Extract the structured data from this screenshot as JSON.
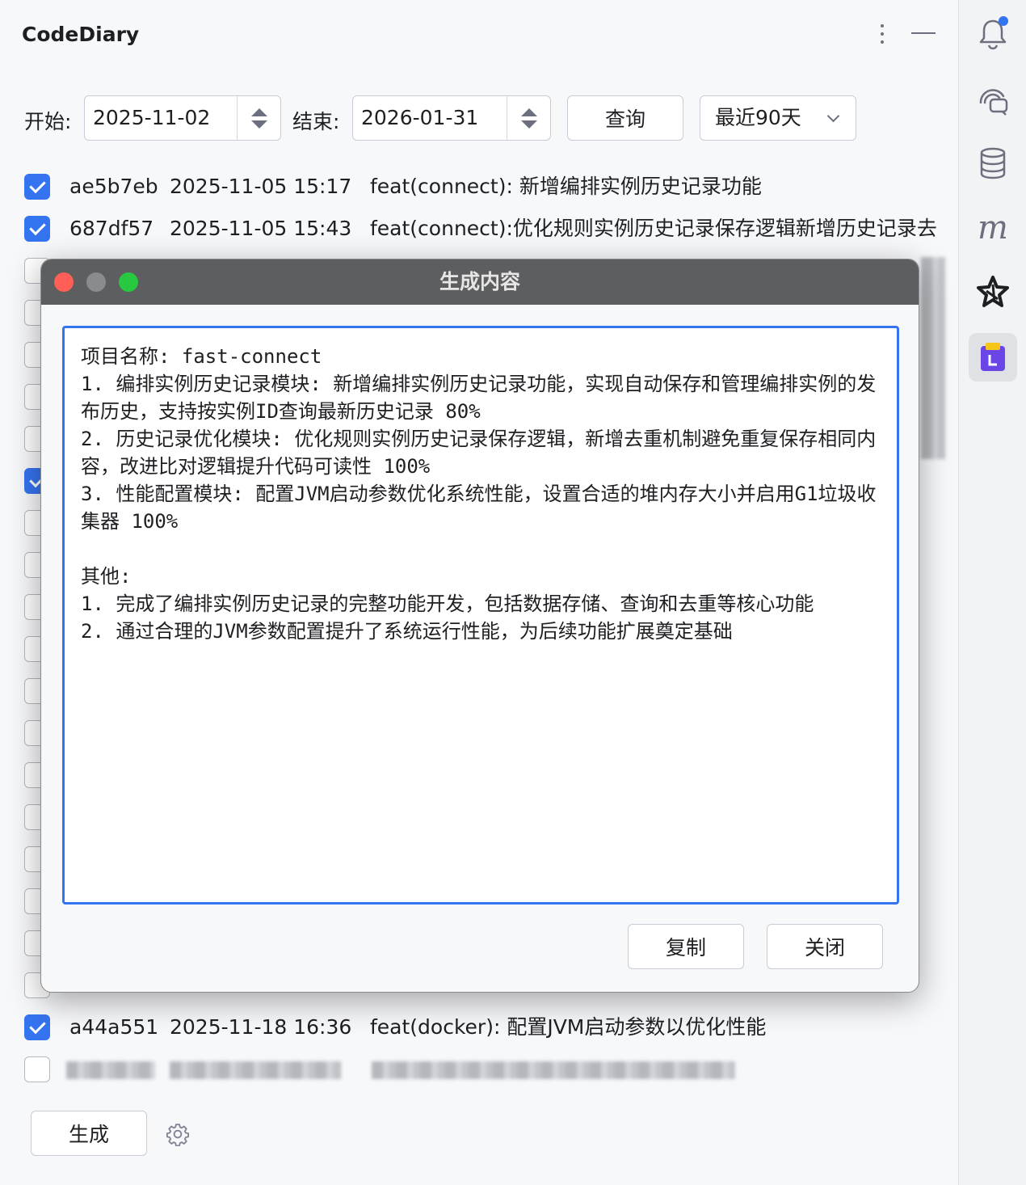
{
  "app": {
    "title": "CodeDiary"
  },
  "filters": {
    "start_label": "开始:",
    "start_value": "2025-11-02",
    "end_label": "结束:",
    "end_value": "2026-01-31",
    "query_label": "查询",
    "range_value": "最近90天"
  },
  "commits": [
    {
      "checked": true,
      "hash": "ae5b7eb",
      "date": "2025-11-05 15:17",
      "message": "feat(connect): 新增编排实例历史记录功能"
    },
    {
      "checked": true,
      "hash": "687df57",
      "date": "2025-11-05 15:43",
      "message": "feat(connect):优化规则实例历史记录保存逻辑新增历史记录去"
    },
    {
      "checked": true,
      "hash": "a44a551",
      "date": "2025-11-18 16:36",
      "message": "feat(docker): 配置JVM启动参数以优化性能"
    }
  ],
  "bottom": {
    "generate_label": "生成"
  },
  "dialog": {
    "title": "生成内容",
    "content": "项目名称: fast-connect\n1. 编排实例历史记录模块: 新增编排实例历史记录功能，实现自动保存和管理编排实例的发布历史，支持按实例ID查询最新历史记录 80%\n2. 历史记录优化模块: 优化规则实例历史记录保存逻辑，新增去重机制避免重复保存相同内容，改进比对逻辑提升代码可读性 100%\n3. 性能配置模块: 配置JVM启动参数优化系统性能，设置合适的堆内存大小并启用G1垃圾收集器 100%\n\n其他:\n1. 完成了编排实例历史记录的完整功能开发，包括数据存储、查询和去重等核心功能\n2. 通过合理的JVM参数配置提升了系统运行性能，为后续功能扩展奠定基础",
    "copy_label": "复制",
    "close_label": "关闭"
  },
  "toolbar": {
    "icons": [
      "notification-icon",
      "ai-chat-icon",
      "database-icon",
      "m-plugin-icon",
      "star-plugin-icon",
      "codediary-plugin-icon"
    ],
    "m_glyph": "m"
  },
  "colors": {
    "accent": "#3574f0",
    "notification_dot": "#3574f0",
    "dialog_bar": "#5d5e60"
  }
}
